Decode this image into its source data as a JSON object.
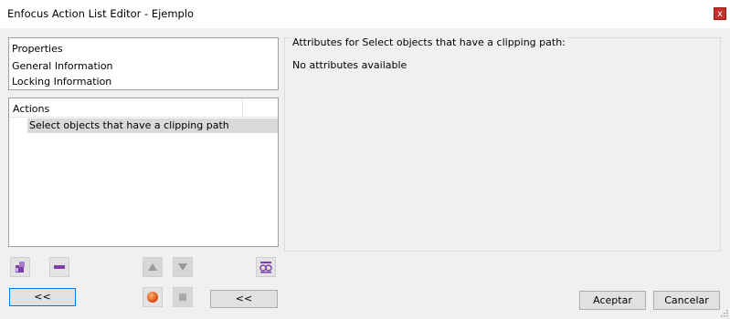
{
  "window": {
    "title": "Enfocus Action List Editor - Ejemplo",
    "close_glyph": "x"
  },
  "properties": {
    "header": "Properties",
    "items": [
      "General Information",
      "Locking Information"
    ]
  },
  "actions": {
    "header": "Actions",
    "items": [
      "Select objects that have a clipping path"
    ],
    "selected_index": 0
  },
  "attributes": {
    "legend": "Attributes for Select objects that have a clipping path:",
    "empty_text": "No attributes available"
  },
  "toolbar": {
    "add_icon": "add-action-icon",
    "remove_icon": "remove-action-icon",
    "move_up_icon": "move-up-icon",
    "move_down_icon": "move-down-icon",
    "view_icon": "preview-glasses-icon",
    "record_icon": "record-icon",
    "stop_icon": "stop-icon",
    "collapse_left_label": "<<",
    "collapse_mid_label": "<<"
  },
  "footer": {
    "ok_label": "Aceptar",
    "cancel_label": "Cancelar"
  },
  "colors": {
    "close_button": "#c4312b",
    "focus_border": "#0078d7",
    "selection": "#d9d9d9",
    "accent_purple": "#7b3fa8",
    "record_orange": "#e8650f"
  }
}
